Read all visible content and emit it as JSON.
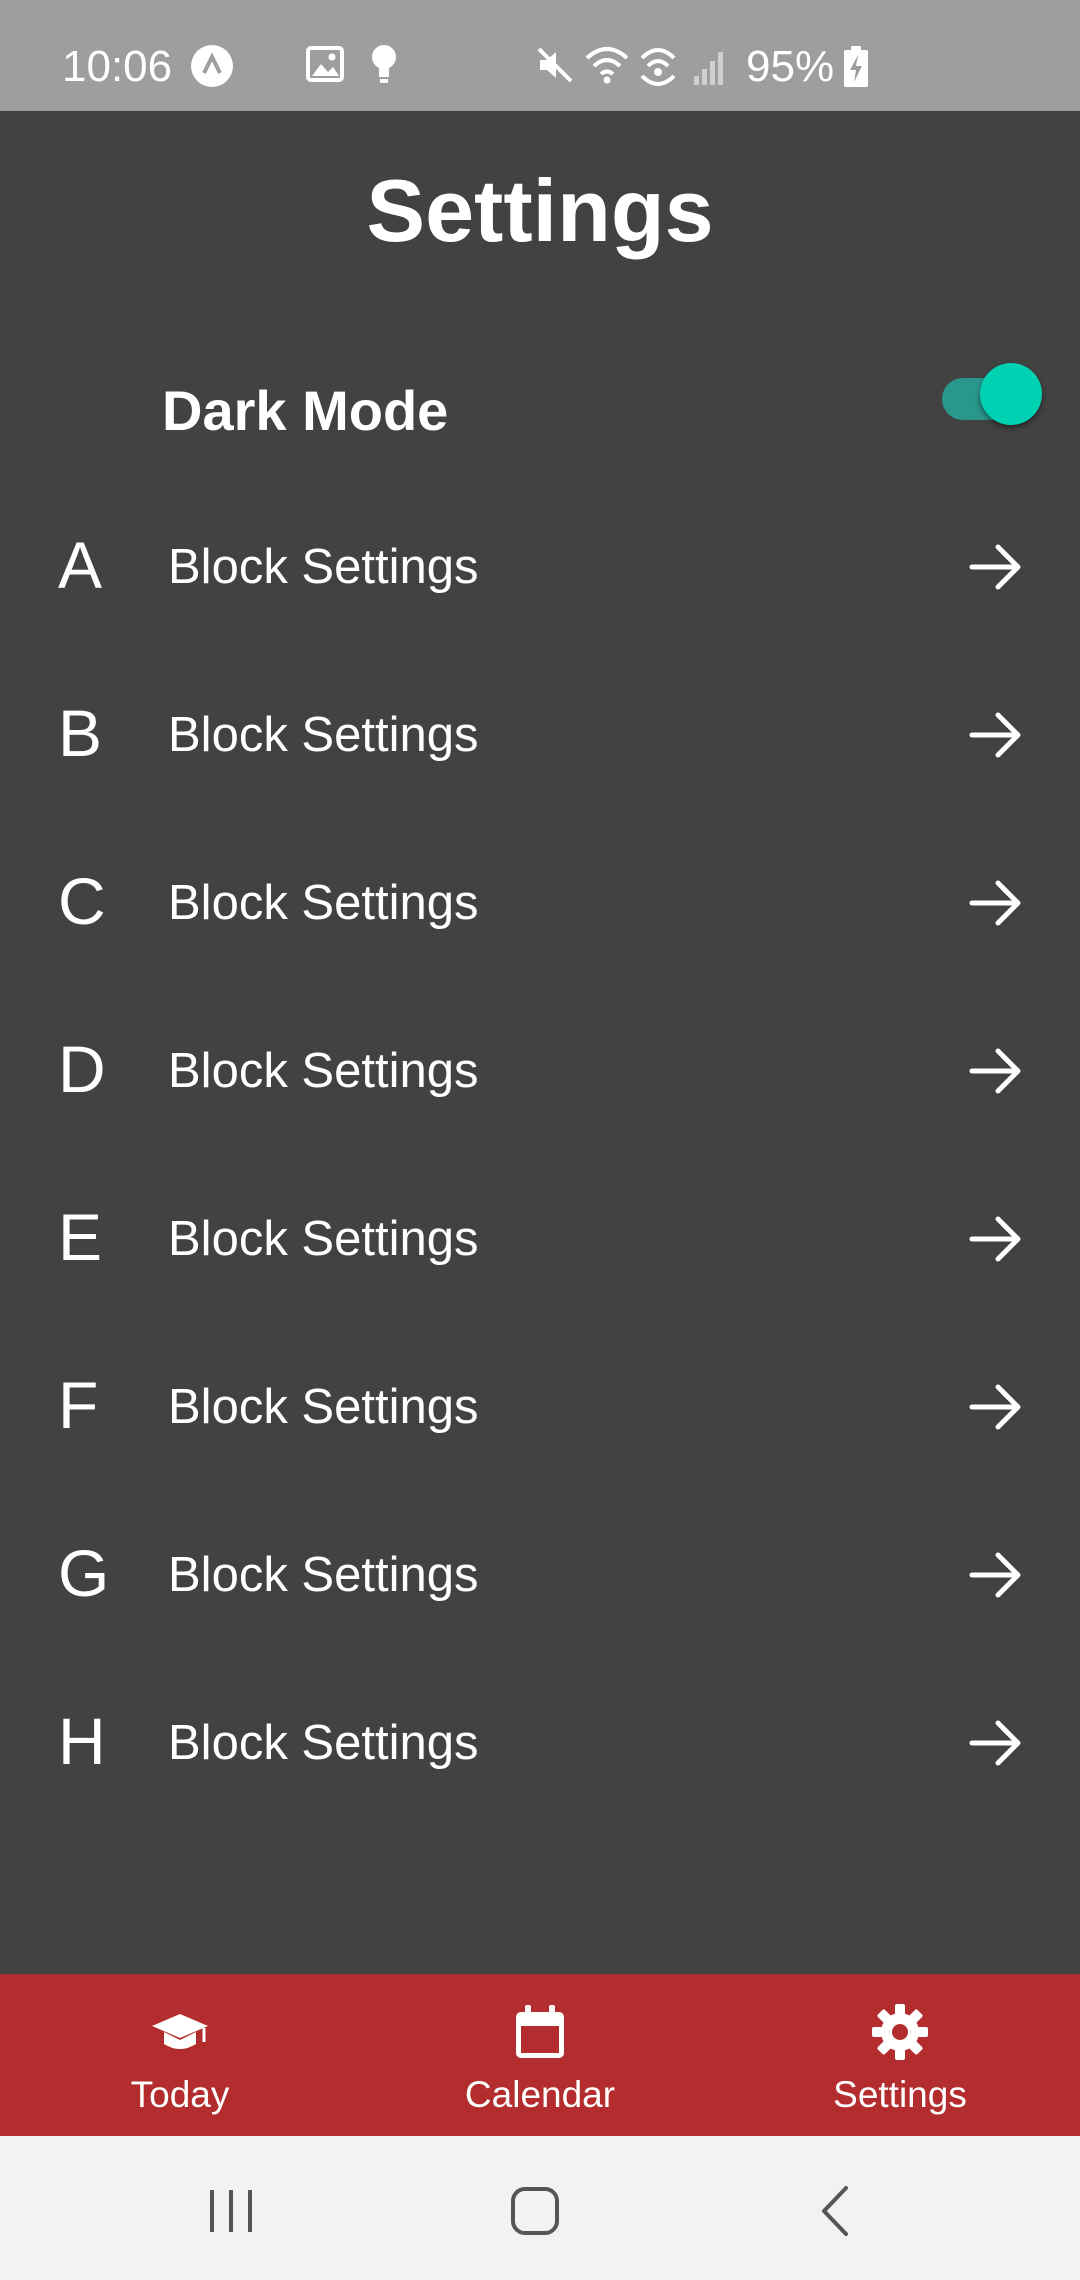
{
  "status_bar": {
    "time": "10:06",
    "battery": "95%",
    "icons": [
      "assistant-icon",
      "image-icon",
      "bulb-icon",
      "mute-icon",
      "wifi-icon",
      "hotspot-icon",
      "signal-icon",
      "battery-charging-icon"
    ]
  },
  "header": {
    "title": "Settings"
  },
  "dark_mode": {
    "label": "Dark Mode",
    "enabled": true,
    "accent_color": "#00d1b2"
  },
  "blocks": [
    {
      "letter": "A",
      "label": "Block Settings"
    },
    {
      "letter": "B",
      "label": "Block Settings"
    },
    {
      "letter": "C",
      "label": "Block Settings"
    },
    {
      "letter": "D",
      "label": "Block Settings"
    },
    {
      "letter": "E",
      "label": "Block Settings"
    },
    {
      "letter": "F",
      "label": "Block Settings"
    },
    {
      "letter": "G",
      "label": "Block Settings"
    },
    {
      "letter": "H",
      "label": "Block Settings"
    }
  ],
  "tab_bar": {
    "color": "#b32d2e",
    "tabs": [
      {
        "label": "Today",
        "icon": "graduation-cap-icon"
      },
      {
        "label": "Calendar",
        "icon": "calendar-icon"
      },
      {
        "label": "Settings",
        "icon": "gear-icon",
        "active": true
      }
    ]
  },
  "nav_bar": {
    "buttons": [
      "recents-icon",
      "home-icon",
      "back-icon"
    ]
  }
}
